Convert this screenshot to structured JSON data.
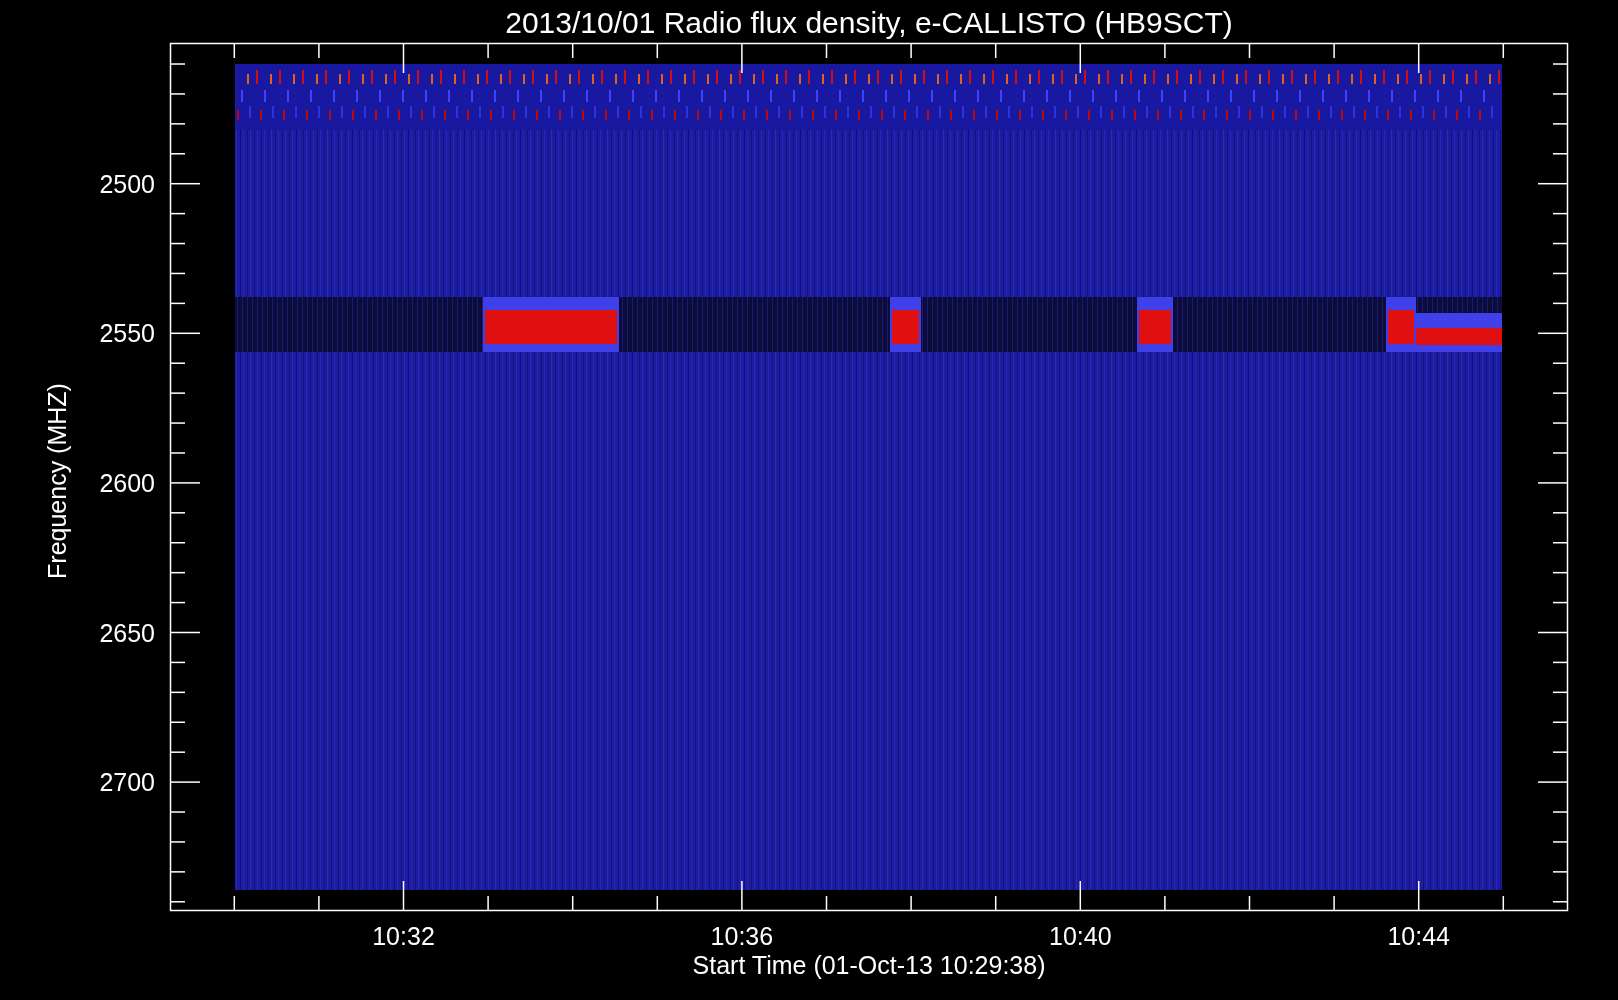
{
  "title": "2013/10/01  Radio flux density, e-CALLISTO (HB9SCT)",
  "y_axis": {
    "label": "Frequency (MHZ)",
    "ticks": [
      "2500",
      "2550",
      "2600",
      "2650",
      "2700"
    ]
  },
  "x_axis": {
    "label": "Start Time (01-Oct-13 10:29:38)",
    "ticks": [
      "10:32",
      "10:36",
      "10:40",
      "10:44"
    ]
  }
}
